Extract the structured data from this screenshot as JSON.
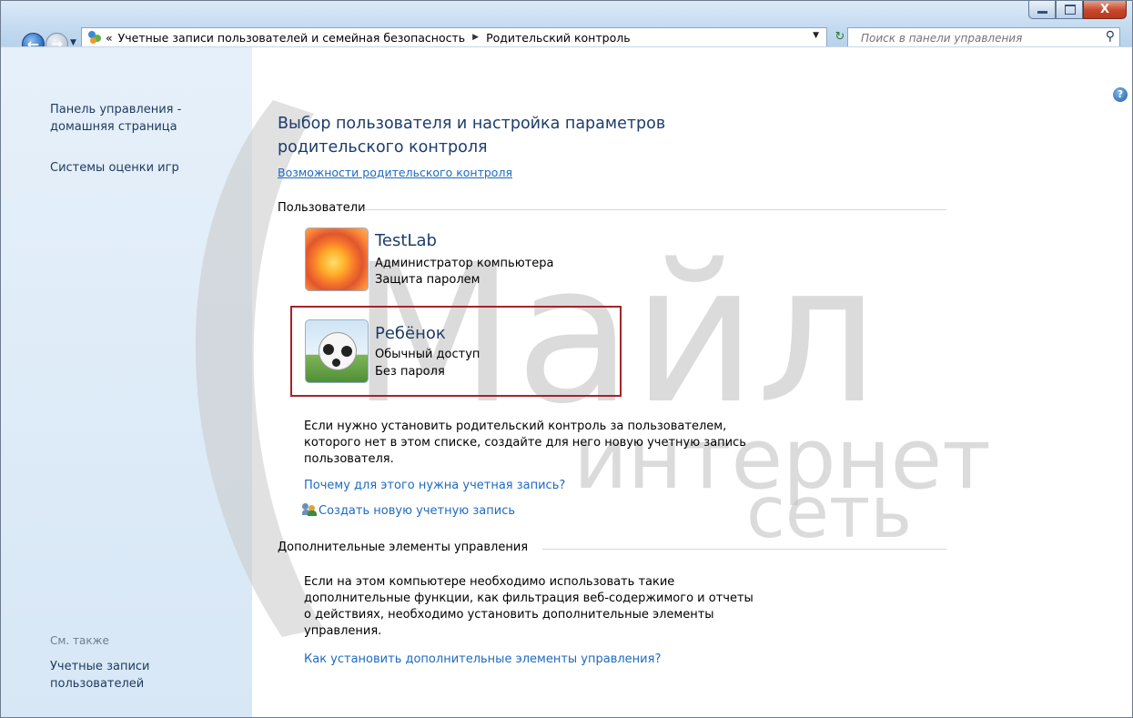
{
  "window": {
    "controls": {
      "minimize": "–",
      "maximize": "□",
      "close": "X"
    }
  },
  "nav": {
    "breadcrumb_prefix": "«",
    "breadcrumb": [
      "Учетные записи пользователей и семейная безопасность",
      "Родительский контроль"
    ],
    "search_placeholder": "Поиск в панели управления",
    "icons": [
      "back-arrow-icon",
      "forward-arrow-icon",
      "control-panel-icon",
      "refresh-icon",
      "search-icon",
      "help-icon"
    ]
  },
  "sidebar": {
    "home_link": "Панель управления -\nдомашняя страница",
    "game_ratings_link": "Системы оценки игр",
    "see_also_label": "См. также",
    "user_accounts_link": "Учетные записи\nпользователей"
  },
  "main": {
    "title": "Выбор пользователя и настройка параметров\nродительского контроля",
    "features_link": "Возможности родительского контроля",
    "users_section": "Пользователи",
    "users": [
      {
        "name": "TestLab",
        "line1": "Администратор компьютера",
        "line2": "Защита паролем",
        "avatar": "flower"
      },
      {
        "name": "Ребёнок",
        "line1": "Обычный доступ",
        "line2": "Без пароля",
        "avatar": "soccer-ball",
        "selected": true
      }
    ],
    "create_hint": "Если нужно установить родительский контроль за пользователем,\nкоторого нет в этом списке, создайте для него новую учетную запись\nпользователя.",
    "why_link": "Почему для этого нужна учетная запись?",
    "create_account_link": "Создать новую учетную запись",
    "extra_section": "Дополнительные элементы управления",
    "extra_text": "Если на этом компьютере необходимо использовать такие\nдополнительные функции, как фильтрация веб-содержимого и отчеты\nо действиях, необходимо установить дополнительные элементы\nуправления.",
    "extra_link": "Как установить дополнительные элементы управления?"
  },
  "watermark": {
    "line1": "Майл",
    "line2": "интернет",
    "line3": "сеть"
  },
  "colors": {
    "link": "#1e6ac1",
    "title": "#1e3c6b",
    "selection_border": "#a4232b",
    "sidebar_bg": "#dce9f6"
  }
}
